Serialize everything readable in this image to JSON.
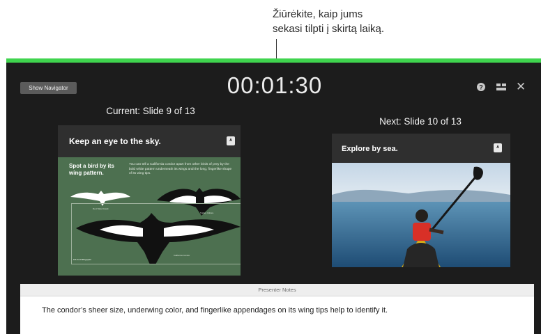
{
  "callout": {
    "line1": "Žiūrėkite, kaip jums",
    "line2": "sekasi tilpti į skirtą laiką."
  },
  "toolbar": {
    "show_navigator_label": "Show Navigator",
    "timer": "00:01:30",
    "icons": [
      "help-icon",
      "layout-icon",
      "close-icon"
    ],
    "close_glyph": "✕"
  },
  "current": {
    "label": "Current: Slide 9 of 13",
    "slide": {
      "title": "Keep an eye to the sky.",
      "subtitle": "Spot a bird by its wing pattern.",
      "body": "You can tell a California condor apart from other birds of prey by the bold white pattern underneath its wings and the long, fingerlike shape of its wing tips.",
      "caption_left": "Red-Tailed Hawk",
      "caption_right": "Turkey Vulture",
      "caption_bottom_left": "9.5-foot Wingspan",
      "caption_bottom_mid": "California Condor"
    }
  },
  "next": {
    "label": "Next: Slide 10 of 13",
    "slide": {
      "title": "Explore by sea."
    }
  },
  "notes": {
    "header": "Presenter Notes",
    "text": "The condor’s sheer size, underwing color, and fingerlike appendages on its wing tips help to identify it."
  },
  "colors": {
    "accent_green": "#3fd44e",
    "window_bg": "#1c1c1c",
    "slide_green": "#4d7050"
  }
}
